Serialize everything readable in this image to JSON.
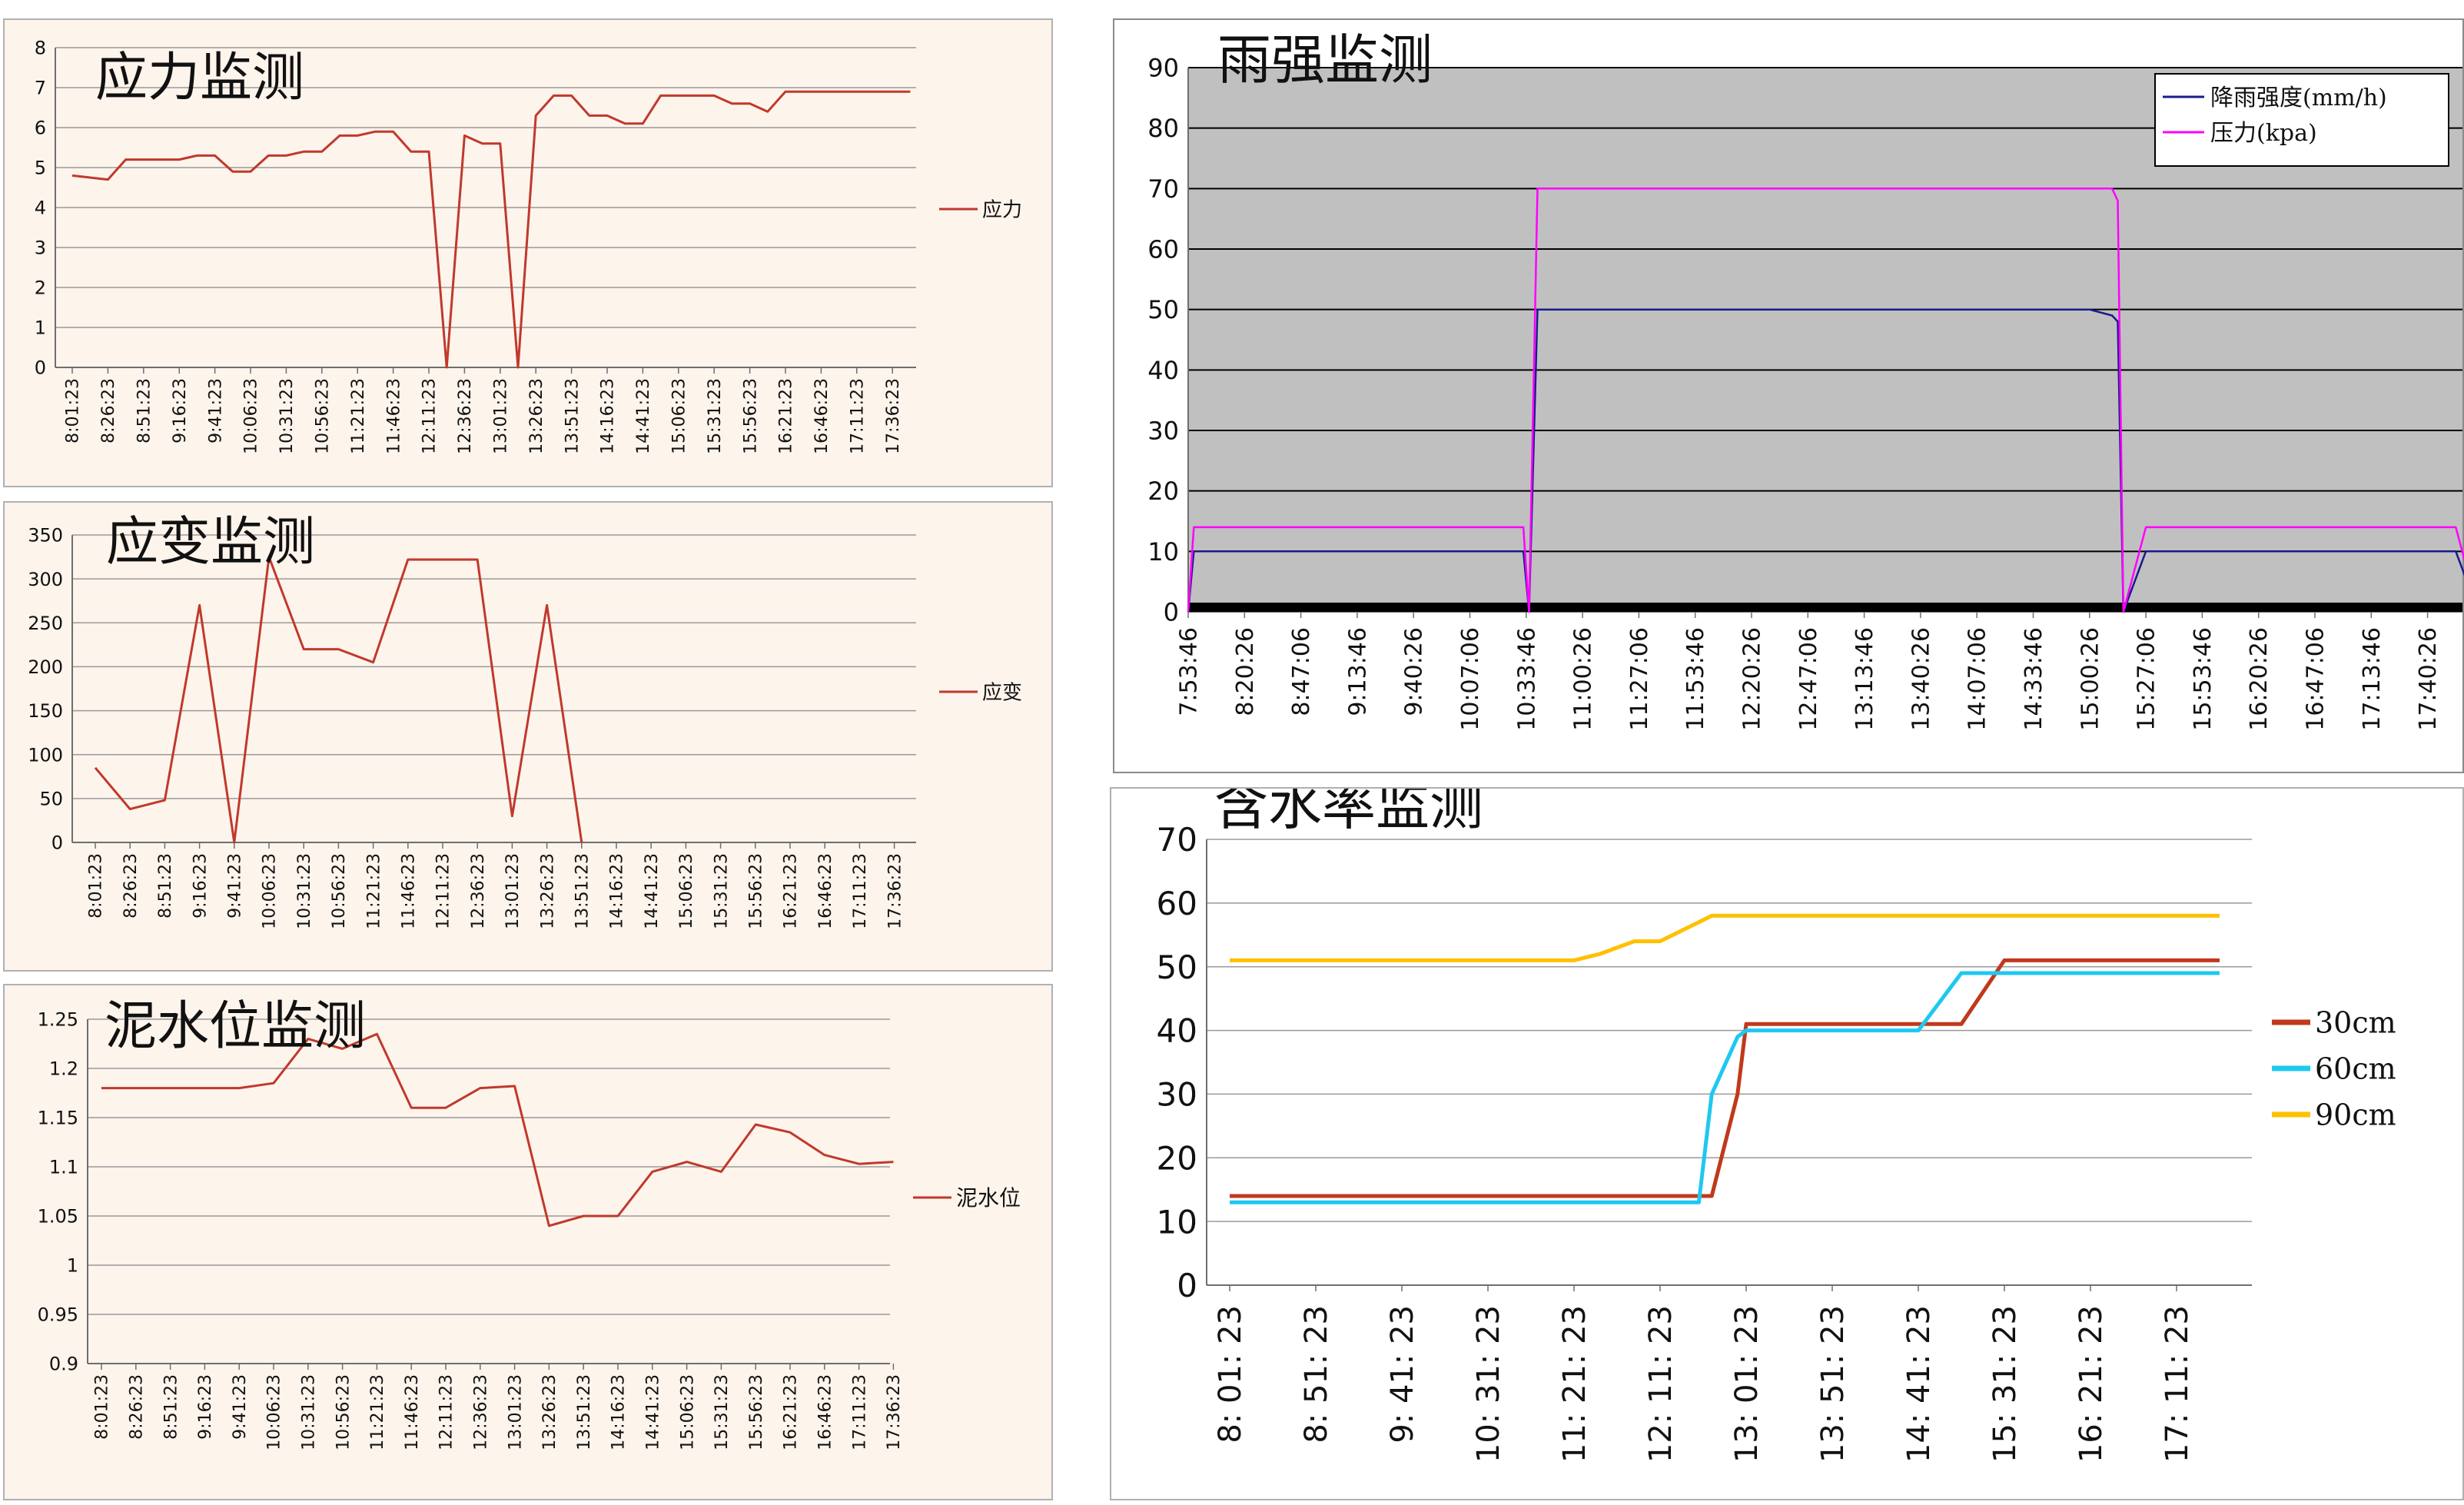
{
  "chart_data": [
    {
      "id": "stress",
      "type": "line",
      "title": "应力监测",
      "categories": [
        "8:01:23",
        "8:26:23",
        "8:51:23",
        "9:16:23",
        "9:41:23",
        "10:06:23",
        "10:31:23",
        "10:56:23",
        "11:21:23",
        "11:46:23",
        "12:11:23",
        "12:36:23",
        "13:01:23",
        "13:26:23",
        "13:51:23",
        "14:16:23",
        "14:41:23",
        "15:06:23",
        "15:31:23",
        "15:56:23",
        "16:21:23",
        "16:46:23",
        "17:11:23",
        "17:36:23"
      ],
      "x": [
        0,
        0.5,
        1,
        1.5,
        2,
        2.5,
        3,
        3.5,
        4,
        4.5,
        5,
        5.5,
        6,
        6.5,
        7,
        7.5,
        8,
        8.5,
        9,
        9.5,
        10,
        10.5,
        11,
        11.5,
        12,
        12.5,
        13,
        13.5,
        14,
        14.5,
        15,
        15.5,
        16,
        16.5,
        17,
        17.5,
        18,
        18.5,
        19,
        19.5,
        20,
        20.5,
        21,
        21.5,
        22,
        22.5,
        23,
        23.5
      ],
      "series": [
        {
          "name": "应力",
          "color": "#c0392b",
          "values": [
            4.8,
            4.75,
            4.7,
            5.2,
            5.2,
            5.2,
            5.2,
            5.3,
            5.3,
            4.9,
            4.9,
            5.3,
            5.3,
            5.4,
            5.4,
            5.8,
            5.8,
            5.9,
            5.9,
            5.4,
            5.4,
            0,
            5.8,
            5.6,
            5.6,
            0,
            6.3,
            6.8,
            6.8,
            6.3,
            6.3,
            6.1,
            6.1,
            6.8,
            6.8,
            6.8,
            6.8,
            6.6,
            6.6,
            6.4,
            6.9,
            6.9,
            6.9,
            6.9,
            6.9,
            6.9,
            6.9,
            6.9
          ]
        }
      ],
      "ylim": [
        0,
        8
      ],
      "yticks": [
        0,
        1,
        2,
        3,
        4,
        5,
        6,
        7,
        8
      ],
      "ytick_labels": [
        "0",
        "1",
        "2",
        "3",
        "4",
        "5",
        "6",
        "7",
        "8"
      ],
      "grid": true,
      "legend": "right"
    },
    {
      "id": "strain",
      "type": "line",
      "title": "应变监测",
      "categories": [
        "8:01:23",
        "8:26:23",
        "8:51:23",
        "9:16:23",
        "9:41:23",
        "10:06:23",
        "10:31:23",
        "10:56:23",
        "11:21:23",
        "11:46:23",
        "12:11:23",
        "12:36:23",
        "13:01:23",
        "13:26:23",
        "13:51:23",
        "14:16:23",
        "14:41:23",
        "15:06:23",
        "15:31:23",
        "15:56:23",
        "16:21:23",
        "16:46:23",
        "17:11:23",
        "17:36:23"
      ],
      "x": [
        0,
        1,
        2,
        3,
        4,
        5,
        6,
        7,
        8,
        9,
        10,
        11,
        12,
        13,
        14
      ],
      "series": [
        {
          "name": "应变",
          "color": "#c0392b",
          "values": [
            85,
            38,
            48,
            270,
            0,
            325,
            220,
            220,
            205,
            322,
            322,
            322,
            30,
            270,
            0
          ]
        }
      ],
      "ylim": [
        0,
        350
      ],
      "yticks": [
        0,
        50,
        100,
        150,
        200,
        250,
        300,
        350
      ],
      "ytick_labels": [
        "0",
        "50",
        "100",
        "150",
        "200",
        "250",
        "300",
        "350"
      ],
      "grid": true,
      "legend": "right"
    },
    {
      "id": "mud",
      "type": "line",
      "title": "泥水位监测",
      "categories": [
        "8:01:23",
        "8:26:23",
        "8:51:23",
        "9:16:23",
        "9:41:23",
        "10:06:23",
        "10:31:23",
        "10:56:23",
        "11:21:23",
        "11:46:23",
        "12:11:23",
        "12:36:23",
        "13:01:23",
        "13:26:23",
        "13:51:23",
        "14:16:23",
        "14:41:23",
        "15:06:23",
        "15:31:23",
        "15:56:23",
        "16:21:23",
        "16:46:23",
        "17:11:23",
        "17:36:23"
      ],
      "x": [
        0,
        1,
        2,
        3,
        4,
        5,
        6,
        7,
        8,
        9,
        10,
        11,
        12,
        13,
        14,
        15,
        16,
        17,
        18,
        19,
        20,
        21,
        22,
        23
      ],
      "series": [
        {
          "name": "泥水位",
          "color": "#c0392b",
          "values": [
            1.18,
            1.18,
            1.18,
            1.18,
            1.18,
            1.185,
            1.23,
            1.22,
            1.235,
            1.16,
            1.16,
            1.18,
            1.182,
            1.04,
            1.05,
            1.05,
            1.095,
            1.105,
            1.095,
            1.143,
            1.135,
            1.112,
            1.103,
            1.105
          ]
        }
      ],
      "ylim": [
        0.9,
        1.25
      ],
      "yticks": [
        0.9,
        0.95,
        1,
        1.05,
        1.1,
        1.15,
        1.2,
        1.25
      ],
      "ytick_labels": [
        "0.9",
        "0.95",
        "1",
        "1.05",
        "1.1",
        "1.15",
        "1.2",
        "1.25"
      ],
      "grid": true,
      "legend": "right"
    },
    {
      "id": "rain",
      "type": "line",
      "title": "雨强监测",
      "categories": [
        "7:53:46",
        "8:20:26",
        "8:47:06",
        "9:13:46",
        "9:40:26",
        "10:07:06",
        "10:33:46",
        "11:00:26",
        "11:27:06",
        "11:53:46",
        "12:20:26",
        "12:47:06",
        "13:13:46",
        "13:40:26",
        "14:07:06",
        "14:33:46",
        "15:00:26",
        "15:27:06",
        "15:53:46",
        "16:20:26",
        "16:47:06",
        "17:13:46",
        "17:40:26"
      ],
      "x": [
        0,
        0.1,
        0.3,
        0.6,
        1,
        2,
        3,
        4,
        5,
        5.95,
        6.05,
        6.2,
        7,
        8,
        9,
        10,
        11,
        12,
        13,
        14,
        15,
        16,
        16.4,
        16.5,
        16.6,
        17,
        18,
        19,
        20,
        21,
        22,
        22.5,
        22.9
      ],
      "series": [
        {
          "name": "降雨强度(mm/h)",
          "color": "#1a1a8c",
          "values": [
            0,
            10,
            10,
            10,
            10,
            10,
            10,
            10,
            10,
            10,
            0,
            50,
            50,
            50,
            50,
            50,
            50,
            50,
            50,
            50,
            50,
            50,
            49,
            48,
            0,
            10,
            10,
            10,
            10,
            10,
            10,
            10,
            0
          ]
        },
        {
          "name": "压力(kpa)",
          "color": "#ff00ff",
          "values": [
            0,
            14,
            14,
            14,
            14,
            14,
            14,
            14,
            14,
            14,
            0,
            70,
            70,
            70,
            70,
            70,
            70,
            70,
            70,
            70,
            70,
            70,
            70,
            68,
            0,
            14,
            14,
            14,
            14,
            14,
            14,
            14,
            0
          ]
        }
      ],
      "ylim": [
        0,
        90
      ],
      "yticks": [
        0,
        10,
        20,
        30,
        40,
        50,
        60,
        70,
        80,
        90
      ],
      "ytick_labels": [
        "0",
        "10",
        "20",
        "30",
        "40",
        "50",
        "60",
        "70",
        "80",
        "90"
      ],
      "plot_background": "#c0c0c0",
      "grid": true,
      "legend": "top-right"
    },
    {
      "id": "water",
      "type": "line",
      "title": "含水率监测",
      "categories": [
        "8: 01: 23",
        "8: 51: 23",
        "9: 41: 23",
        "10: 31: 23",
        "11: 21: 23",
        "12: 11: 23",
        "13: 01: 23",
        "13: 51: 23",
        "14: 41: 23",
        "15: 31: 23",
        "16: 21: 23",
        "17: 11: 23"
      ],
      "x": [
        0,
        1,
        2,
        3,
        4,
        4.3,
        4.7,
        5,
        5.3,
        5.45,
        5.6,
        5.9,
        6,
        6.5,
        6.6,
        7,
        7.5,
        8,
        8.5,
        9,
        9.5,
        10,
        10.5,
        11,
        11.5
      ],
      "series": [
        {
          "name": "30cm",
          "color": "#c0391b",
          "values": [
            14,
            14,
            14,
            14,
            14,
            14,
            14,
            14,
            14,
            14,
            14,
            30,
            41,
            41,
            41,
            41,
            41,
            41,
            41,
            51,
            51,
            51,
            51,
            51,
            51
          ]
        },
        {
          "name": "60cm",
          "color": "#1ec8f0",
          "values": [
            13,
            13,
            13,
            13,
            13,
            13,
            13,
            13,
            13,
            13,
            30,
            39,
            40,
            40,
            40,
            40,
            40,
            40,
            49,
            49,
            49,
            49,
            49,
            49,
            49
          ]
        },
        {
          "name": "90cm",
          "color": "#ffc000",
          "values": [
            51,
            51,
            51,
            51,
            51,
            52,
            54,
            54,
            56,
            57,
            58,
            58,
            58,
            58,
            58,
            58,
            58,
            58,
            58,
            58,
            58,
            58,
            58,
            58,
            58
          ]
        }
      ],
      "ylim": [
        0,
        70
      ],
      "yticks": [
        0,
        10,
        20,
        30,
        40,
        50,
        60,
        70
      ],
      "ytick_labels": [
        "0",
        "10",
        "20",
        "30",
        "40",
        "50",
        "60",
        "70"
      ],
      "grid": true,
      "legend": "right"
    }
  ]
}
